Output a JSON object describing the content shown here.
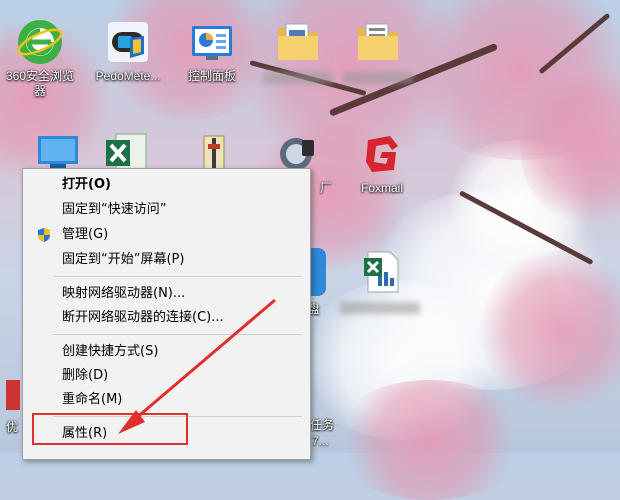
{
  "desktop_icons": [
    {
      "id": "browser360",
      "label_line1": "360安全浏览",
      "label_line2": "器",
      "icon": "360-browser-icon"
    },
    {
      "id": "pedometer",
      "label_line1": "PedoMete...",
      "icon": "pedometer-icon"
    },
    {
      "id": "control_panel",
      "label_line1": "控制面板",
      "icon": "control-panel-icon"
    },
    {
      "id": "folder1",
      "label_line1": "",
      "icon": "folder-icon"
    },
    {
      "id": "folder2",
      "label_line1": "",
      "icon": "folder-icon"
    },
    {
      "id": "foxmail",
      "label_line1": "Foxmail",
      "icon": "foxmail-icon"
    },
    {
      "id": "excel_doc",
      "label_line1": "",
      "icon": "excel-file-icon"
    }
  ],
  "partial_labels": {
    "left_bottom": "优",
    "right_mid": "盘",
    "right_bottom_1": "任务",
    "right_bottom_2": "7..."
  },
  "context_menu": {
    "items": [
      {
        "label": "打开(O)",
        "bold": true
      },
      {
        "label": "固定到“快速访问”"
      },
      {
        "label": "管理(G)",
        "icon": "shield-icon"
      },
      {
        "label": "固定到“开始”屏幕(P)"
      },
      {
        "label": "映射网络驱动器(N)..."
      },
      {
        "label": "断开网络驱动器的连接(C)..."
      },
      {
        "label": "创建快捷方式(S)"
      },
      {
        "label": "删除(D)"
      },
      {
        "label": "重命名(M)"
      },
      {
        "label": "属性(R)"
      }
    ]
  },
  "colors": {
    "highlight": "#e0302e",
    "menu_bg": "#f2f2f2"
  }
}
